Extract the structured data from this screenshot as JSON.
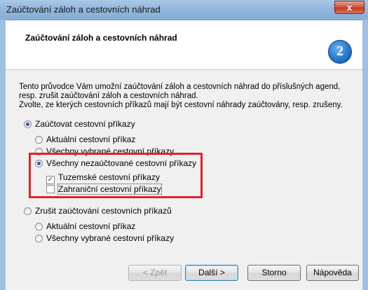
{
  "window": {
    "title": "Zaúčtování záloh a cestovních náhrad",
    "close_glyph": "x"
  },
  "header": {
    "title": "Zaúčtování záloh a cestovních náhrad",
    "logo_letter": "2"
  },
  "description": {
    "line1": "Tento průvodce Vám umožní zaúčtování záloh a cestovních náhrad do příslušných agend,",
    "line2": "resp. zrušit zaúčtování záloh a cestovních náhrad.",
    "line3": "Zvolte, ze kterých cestovních příkazů mají být cestovní náhrady zaúčtovány, resp. zrušeny."
  },
  "options": {
    "account": {
      "label": "Zaúčtovat cestovní příkazy",
      "selected": true
    },
    "account_sub": [
      {
        "label": "Aktuální cestovní příkaz",
        "selected": false
      },
      {
        "label": "Všechny vybrané cestovní příkazy",
        "selected": false
      },
      {
        "label": "Všechny nezaúčtované cestovní příkazy",
        "selected": true
      }
    ],
    "checks": [
      {
        "label": "Tuzemské cestovní příkazy",
        "checked": true
      },
      {
        "label": "Zahraniční cestovní příkazy",
        "checked": false
      }
    ],
    "cancel": {
      "label": "Zrušit zaúčtování cestovních příkazů",
      "selected": false
    },
    "cancel_sub": [
      {
        "label": "Aktuální cestovní příkaz",
        "selected": false
      },
      {
        "label": "Všechny vybrané cestovní příkazy",
        "selected": false
      }
    ]
  },
  "buttons": {
    "back": "< Zpět",
    "next": "Další >",
    "cancel": "Storno",
    "help": "Nápověda"
  },
  "colors": {
    "highlight_border": "#e02030",
    "titlebar": "#93b7dd",
    "close": "#c23a22"
  }
}
